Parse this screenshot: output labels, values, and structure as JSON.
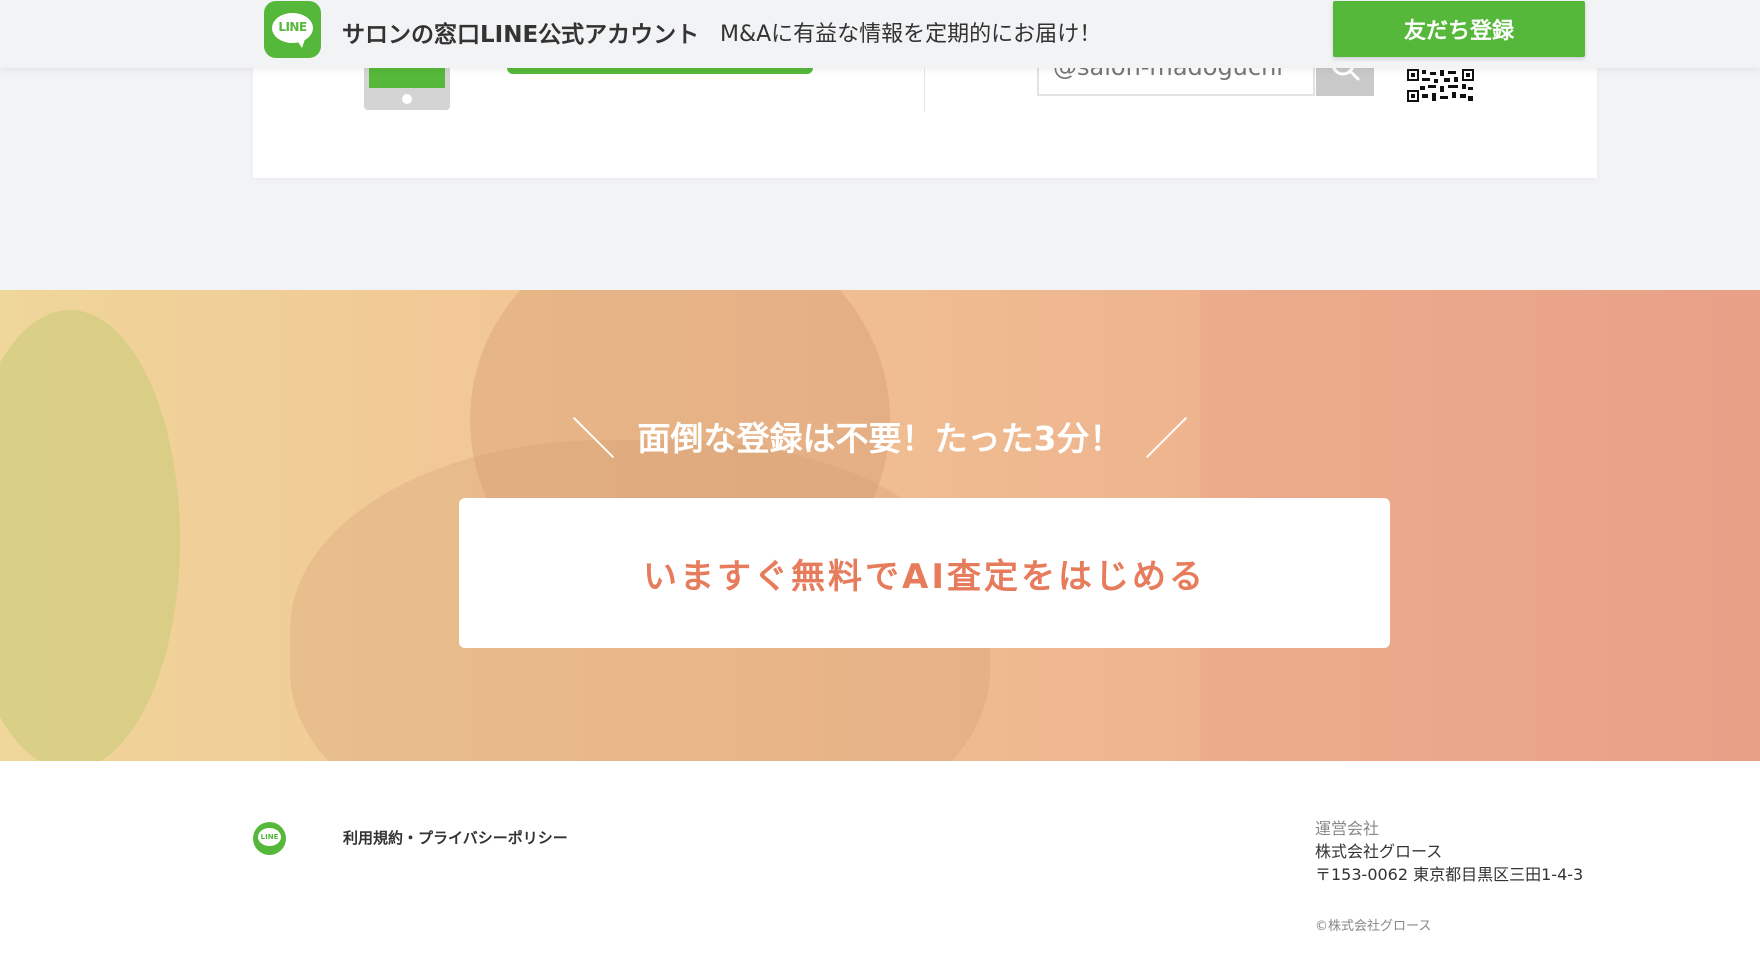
{
  "line_banner": {
    "title": "サロンの窓口LINE公式アカウント",
    "subtitle": "M&Aに有益な情報を定期的にお届け！",
    "logo_text": "LINE",
    "button_label": "友だち登録"
  },
  "line_card": {
    "id_value": "@salon-madoguchi"
  },
  "hero": {
    "tagline": "面倒な登録は不要！たった3分！",
    "slash_left": "＼",
    "slash_right": "／",
    "cta_label": "いますぐ無料でAI査定をはじめる"
  },
  "footer": {
    "logo_text": "LINE",
    "links": [
      "利用規約",
      "プライバシーポリシー"
    ],
    "link_separator": "・",
    "company_label": "運営会社",
    "company_name": "株式会社グロース",
    "company_address": "〒153-0062 東京都目黒区三田1-4-3",
    "copyright": "©株式会社グロース"
  },
  "colors": {
    "line_green": "#56b83a",
    "cta_text": "#e77c5c",
    "page_bg": "#f2f3f5"
  },
  "icons": [
    "line-logo-icon",
    "tablet-icon",
    "search-icon",
    "qr-code-icon"
  ]
}
